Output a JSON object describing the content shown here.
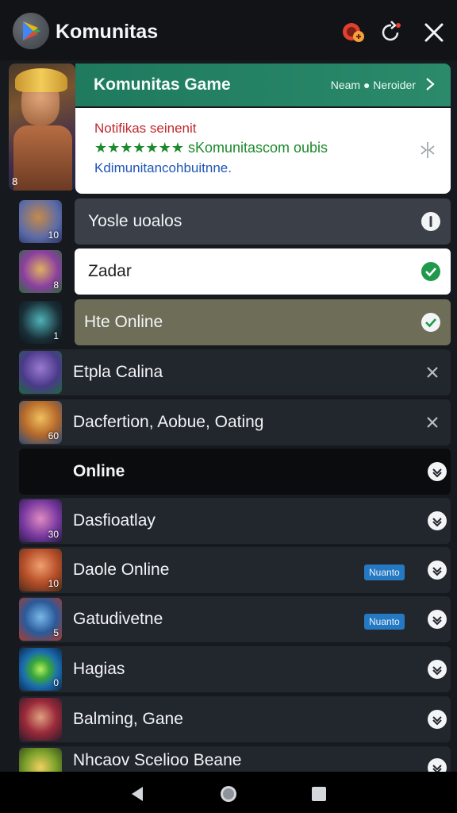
{
  "app": {
    "title": "Komunitas",
    "icons": [
      "game-controller-icon",
      "refresh-icon",
      "close-icon"
    ]
  },
  "banner": {
    "title": "Komunitas Game",
    "right_text": "Neam ● Neroider",
    "chevron_icon": "chevron-right-icon"
  },
  "notification": {
    "line1": "Notifikas seinenit",
    "line2": "★★★★★★★ sKomunitascom oubis",
    "line3": "Kdimunitancohbuitnne.",
    "icon": "collapse-icon"
  },
  "hero": {
    "number": "8"
  },
  "rows": [
    {
      "label": "Yosle uoalos",
      "thumb_num": "10",
      "status_icon": "info-icon",
      "style": "dark-card"
    },
    {
      "label": "Zadar",
      "thumb_num": "8",
      "status_icon": "check-circle-icon",
      "style": "white-card"
    },
    {
      "label": "Hte Online",
      "thumb_num": "1",
      "status_icon": "check-icon",
      "style": "olive-card"
    },
    {
      "label": "Etpla Calina",
      "thumb_num": "",
      "status_icon": "close-icon",
      "style": "row-plain"
    },
    {
      "label": "Dacfertion, Aobue, Oating",
      "thumb_num": "60",
      "status_icon": "close-icon",
      "style": "row-plain"
    },
    {
      "label": "Online",
      "thumb_num": "",
      "status_icon": "chevron-down-circle-icon",
      "style": "section-header"
    },
    {
      "label": "Dasfioatlay",
      "thumb_num": "30",
      "status_icon": "chevron-down-circle-icon",
      "style": "row-plain"
    },
    {
      "label": "Daole Online",
      "thumb_num": "10",
      "status_icon": "chevron-down-circle-icon",
      "badge": "Nuanto",
      "style": "row-plain"
    },
    {
      "label": "Gatudivetne",
      "thumb_num": "5",
      "status_icon": "chevron-down-circle-icon",
      "badge": "Nuanto",
      "style": "row-plain"
    },
    {
      "label": "Hagias",
      "thumb_num": "0",
      "status_icon": "chevron-down-circle-icon",
      "style": "row-plain"
    },
    {
      "label": "Balming, Gane",
      "thumb_num": "",
      "status_icon": "chevron-down-circle-icon",
      "style": "row-plain"
    },
    {
      "label": "Nhcaov Scelioo Beane",
      "thumb_num": "",
      "status_icon": "chevron-down-circle-icon",
      "style": "row-plain"
    }
  ],
  "nav": {
    "back_icon": "back-icon",
    "home_icon": "home-icon",
    "recents_icon": "recents-icon"
  },
  "colors": {
    "accent_green": "#1f7a5e",
    "check_green": "#1f9a4a",
    "badge_blue": "#2479c2",
    "background": "#16191e"
  }
}
